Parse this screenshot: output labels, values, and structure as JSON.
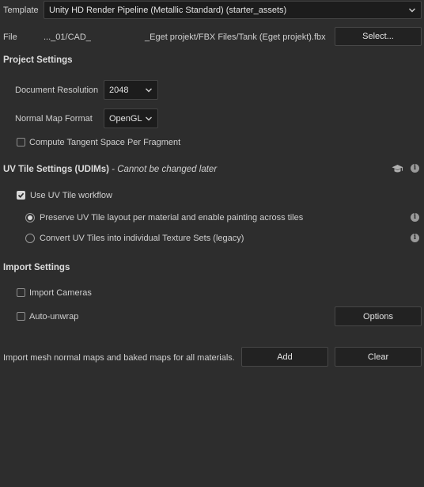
{
  "template": {
    "label": "Template",
    "value": "Unity HD Render Pipeline (Metallic Standard) (starter_assets)"
  },
  "file": {
    "label": "File",
    "path_start": "..._01/CAD_",
    "path_end": "_Eget projekt/FBX Files/Tank (Eget projekt).fbx",
    "select_label": "Select..."
  },
  "project_settings": {
    "header": "Project Settings",
    "document_resolution_label": "Document Resolution",
    "document_resolution_value": "2048",
    "normal_map_format_label": "Normal Map Format",
    "normal_map_format_value": "OpenGL",
    "compute_tangent_label": "Compute Tangent Space Per Fragment",
    "compute_tangent_checked": false
  },
  "uv_tile": {
    "header": "UV Tile Settings (UDIMs)",
    "header_suffix": " - Cannot be changed later",
    "use_workflow_label": "Use UV Tile workflow",
    "use_workflow_checked": true,
    "option_preserve": "Preserve UV Tile layout per material and enable painting across tiles",
    "option_convert": "Convert UV Tiles into individual Texture Sets (legacy)",
    "selected_option": "preserve"
  },
  "import_settings": {
    "header": "Import Settings",
    "import_cameras_label": "Import Cameras",
    "import_cameras_checked": false,
    "auto_unwrap_label": "Auto-unwrap",
    "auto_unwrap_checked": false,
    "options_label": "Options"
  },
  "baked_maps": {
    "description": "Import mesh normal maps and baked maps for all materials.",
    "add_label": "Add",
    "clear_label": "Clear"
  },
  "icons": {
    "info": "info-icon",
    "academy": "graduation-cap-icon",
    "dropdown": "chevron-down-icon"
  },
  "colors": {
    "background": "#2d2d2d",
    "field": "#1c1c1c",
    "button": "#222222",
    "border": "#474747",
    "text": "#d8d8d8"
  }
}
